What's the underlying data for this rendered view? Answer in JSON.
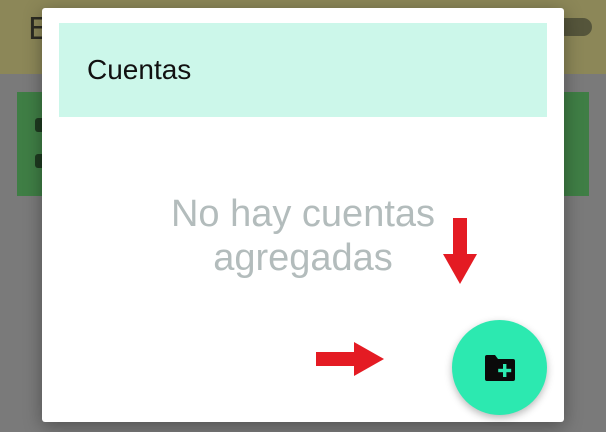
{
  "background": {
    "header_title": "E",
    "card_color": "#3f7e45",
    "header_color": "#8c8758"
  },
  "dialog": {
    "title": "Cuentas",
    "empty_message_line1": "No hay cuentas",
    "empty_message_line2": "agregadas",
    "header_color": "#ccf7ea",
    "add_button_icon": "folder-plus-icon",
    "add_button_color": "#2ce9b0"
  },
  "annotations": {
    "arrow_color": "#e41b23",
    "arrows": [
      "arrow-down",
      "arrow-right"
    ]
  }
}
